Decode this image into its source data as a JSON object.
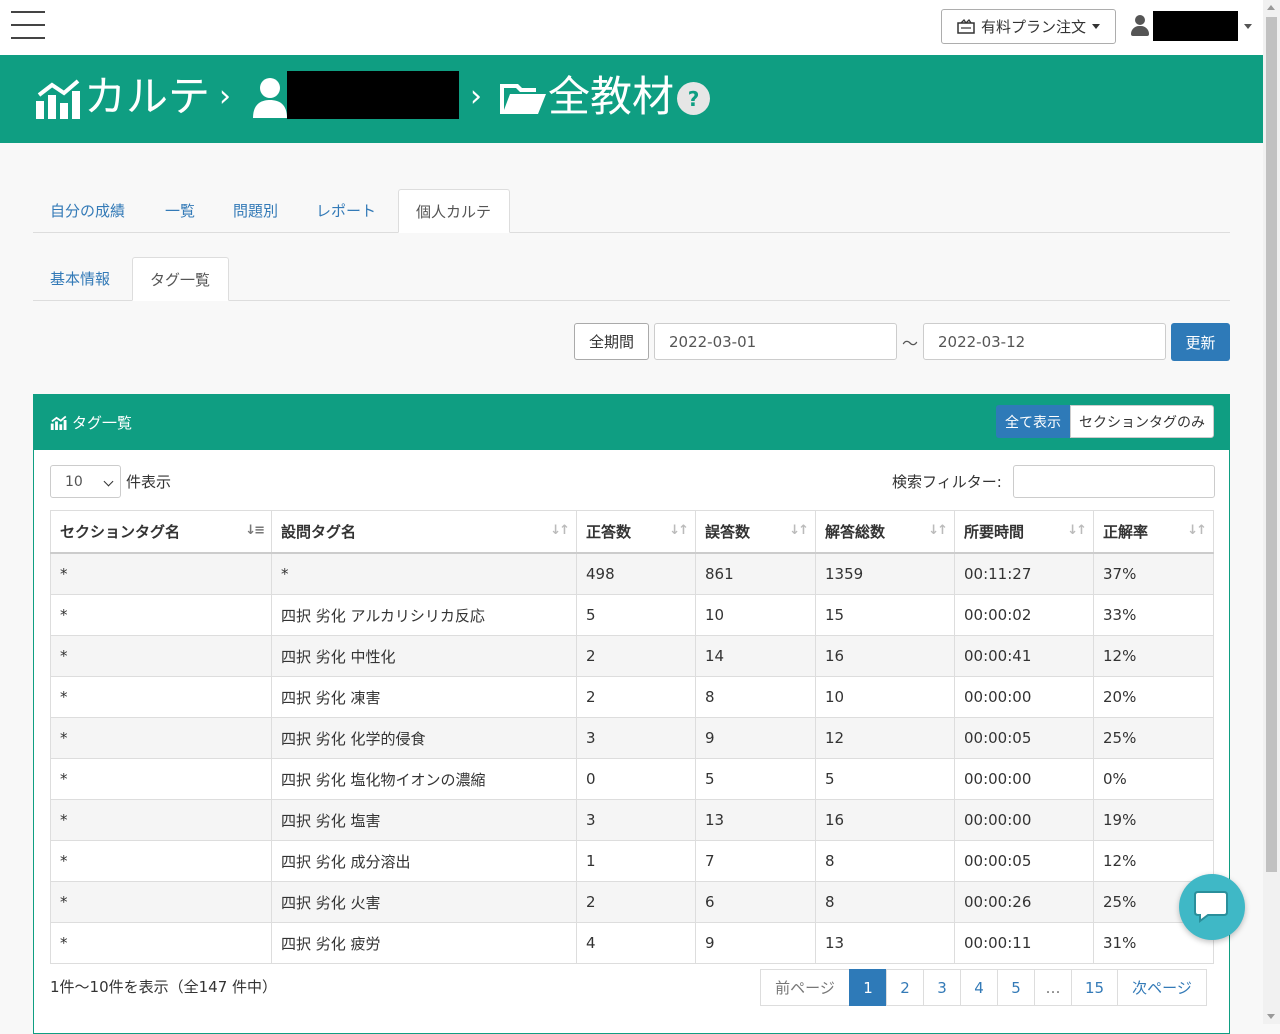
{
  "topbar": {
    "plan_button": "有料プラン注文",
    "plan_icon": "purchase-icon",
    "user_icon": "user-icon"
  },
  "header": {
    "app_title": "カルテ",
    "current_title": "全教材",
    "help_label": "?",
    "logo_icon": "chart-logo-icon",
    "folder_icon": "folder-open-icon"
  },
  "main_tabs": [
    {
      "label": "自分の成績"
    },
    {
      "label": "一覧"
    },
    {
      "label": "問題別"
    },
    {
      "label": "レポート"
    },
    {
      "label": "個人カルテ",
      "active": true
    }
  ],
  "sub_tabs": [
    {
      "label": "基本情報"
    },
    {
      "label": "タグ一覧",
      "active": true
    }
  ],
  "date_range": {
    "all_period_label": "全期間",
    "start": "2022-03-01",
    "separator": "〜",
    "end": "2022-03-12",
    "update_label": "更新"
  },
  "panel": {
    "title": "タグ一覧",
    "toggle_all": "全て表示",
    "toggle_section": "セクションタグのみ",
    "length_value": "10",
    "length_label": "件表示",
    "filter_label": "検索フィルター:"
  },
  "table": {
    "columns": [
      "セクションタグ名",
      "設問タグ名",
      "正答数",
      "誤答数",
      "解答総数",
      "所要時間",
      "正解率"
    ],
    "rows": [
      [
        "*",
        "*",
        "498",
        "861",
        "1359",
        "00:11:27",
        "37%"
      ],
      [
        "*",
        "四択 劣化 アルカリシリカ反応",
        "5",
        "10",
        "15",
        "00:00:02",
        "33%"
      ],
      [
        "*",
        "四択 劣化 中性化",
        "2",
        "14",
        "16",
        "00:00:41",
        "12%"
      ],
      [
        "*",
        "四択 劣化 凍害",
        "2",
        "8",
        "10",
        "00:00:00",
        "20%"
      ],
      [
        "*",
        "四択 劣化 化学的侵食",
        "3",
        "9",
        "12",
        "00:00:05",
        "25%"
      ],
      [
        "*",
        "四択 劣化 塩化物イオンの濃縮",
        "0",
        "5",
        "5",
        "00:00:00",
        "0%"
      ],
      [
        "*",
        "四択 劣化 塩害",
        "3",
        "13",
        "16",
        "00:00:00",
        "19%"
      ],
      [
        "*",
        "四択 劣化 成分溶出",
        "1",
        "7",
        "8",
        "00:00:05",
        "12%"
      ],
      [
        "*",
        "四択 劣化 火害",
        "2",
        "6",
        "8",
        "00:00:26",
        "25%"
      ],
      [
        "*",
        "四択 劣化 疲労",
        "4",
        "9",
        "13",
        "00:00:11",
        "31%"
      ]
    ]
  },
  "pagination": {
    "info": "1件〜10件を表示（全147 件中）",
    "prev": "前ページ",
    "pages": [
      "1",
      "2",
      "3",
      "4",
      "5",
      "…",
      "15"
    ],
    "current": "1",
    "next": "次ページ"
  },
  "colors": {
    "brand": "#0f9e82",
    "primary": "#2e7ab8",
    "chat": "#3fb8c6"
  }
}
